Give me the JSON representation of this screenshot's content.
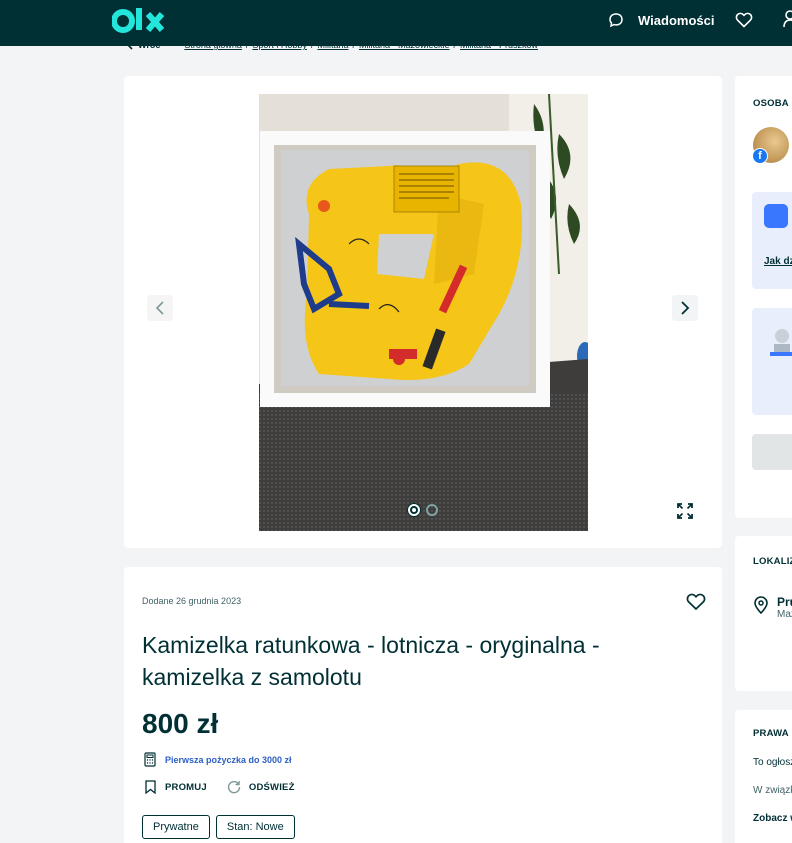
{
  "header": {
    "logo_text": "olx",
    "messages_label": "Wiadomości",
    "accent_color": "#23e5db",
    "background_color": "#002f34"
  },
  "breadcrumb": {
    "back_label": "Wróć",
    "items": [
      "Strona główna",
      "Sport i Hobby",
      "Militaria",
      "Militaria - Mazowieckie",
      "Militaria - Pruszków"
    ]
  },
  "gallery": {
    "current_photo": 1,
    "total_photos": 2
  },
  "listing": {
    "posted_date": "Dodane 26 grudnia 2023",
    "title": "Kamizelka ratunkowa - lotnicza - oryginalna - kamizelka z samolotu",
    "price": "800 zł",
    "loan_link": "Pierwsza pożyczka do 3000 zł",
    "promote_label": "PROMUJ",
    "refresh_label": "ODŚWIEŻ",
    "tags": [
      "Prywatne",
      "Stan: Nowe"
    ]
  },
  "sidebar": {
    "seller_heading": "OSOBA PRYWATNA",
    "promo_link": "Jak działa",
    "location_heading": "LOKALIZACJA",
    "location_city": "Pruszków",
    "location_region": "Mazowieckie",
    "rights_heading": "PRAWA KONSUMENTA",
    "rights_text1": "To ogłoszenie",
    "rights_text2": "W związku",
    "rights_link": "Zobacz więcej"
  }
}
